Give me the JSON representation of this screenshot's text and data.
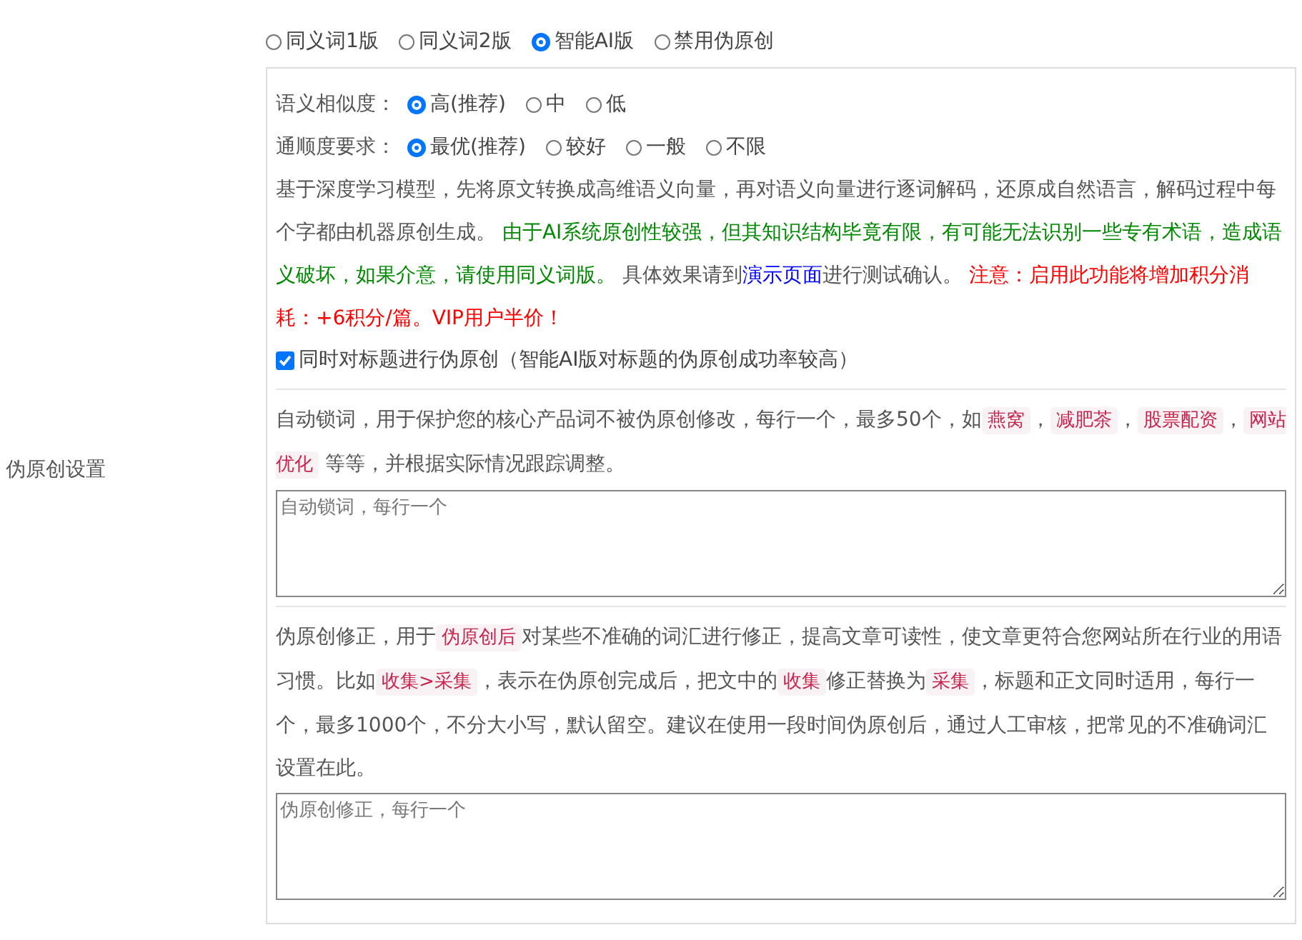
{
  "settings_label": "伪原创设置",
  "versions": [
    {
      "label": "同义词1版",
      "selected": false
    },
    {
      "label": "同义词2版",
      "selected": false
    },
    {
      "label": "智能AI版",
      "selected": true
    },
    {
      "label": "禁用伪原创",
      "selected": false
    }
  ],
  "similarity": {
    "label": "语义相似度：",
    "options": [
      {
        "label": "高(推荐)",
        "selected": true
      },
      {
        "label": "中",
        "selected": false
      },
      {
        "label": "低",
        "selected": false
      }
    ]
  },
  "fluency": {
    "label": "通顺度要求：",
    "options": [
      {
        "label": "最优(推荐)",
        "selected": true
      },
      {
        "label": "较好",
        "selected": false
      },
      {
        "label": "一般",
        "selected": false
      },
      {
        "label": "不限",
        "selected": false
      }
    ]
  },
  "description": [
    {
      "kind": "text",
      "text": "基于深度学习模型，先将原文转换成高维语义向量，再对语义向量进行逐词解码，还原成自然语言，解码过程中每个字都由机器原创生成。 "
    },
    {
      "kind": "green",
      "text": "由于AI系统原创性较强，但其知识结构毕竟有限，有可能无法识别一些专有术语，造成语义破坏，如果介意，请使用同义词版。"
    },
    {
      "kind": "text",
      "text": " 具体效果请到"
    },
    {
      "kind": "link",
      "text": "演示页面"
    },
    {
      "kind": "text",
      "text": "进行测试确认。 "
    },
    {
      "kind": "red",
      "text": "注意：启用此功能将增加积分消耗：+6积分/篇。VIP用户半价！"
    }
  ],
  "title_option": {
    "label": "同时对标题进行伪原创（智能AI版对标题的伪原创成功率较高）",
    "checked": true
  },
  "lock_words": {
    "description": [
      {
        "kind": "text",
        "text": "自动锁词，用于保护您的核心产品词不被伪原创修改，每行一个，最多50个，如"
      },
      {
        "kind": "code",
        "text": "燕窝"
      },
      {
        "kind": "text",
        "text": "，"
      },
      {
        "kind": "code",
        "text": "减肥茶"
      },
      {
        "kind": "text",
        "text": "，"
      },
      {
        "kind": "code",
        "text": "股票配资"
      },
      {
        "kind": "text",
        "text": "，"
      },
      {
        "kind": "code",
        "text": "网站优化"
      },
      {
        "kind": "text",
        "text": " 等等，并根据实际情况跟踪调整。"
      }
    ],
    "placeholder": "自动锁词，每行一个"
  },
  "correction": {
    "description": [
      {
        "kind": "text",
        "text": "伪原创修正，用于"
      },
      {
        "kind": "code",
        "text": "伪原创后"
      },
      {
        "kind": "text",
        "text": "对某些不准确的词汇进行修正，提高文章可读性，使文章更符合您网站所在行业的用语习惯。比如"
      },
      {
        "kind": "code",
        "text": "收集>采集"
      },
      {
        "kind": "text",
        "text": "，表示在伪原创完成后，把文中的"
      },
      {
        "kind": "code",
        "text": "收集"
      },
      {
        "kind": "text",
        "text": "修正替换为"
      },
      {
        "kind": "code",
        "text": "采集"
      },
      {
        "kind": "text",
        "text": "，标题和正文同时适用，每行一个，最多1000个，不分大小写，默认留空。建议在使用一段时间伪原创后，通过人工审核，把常见的不准确词汇设置在此。"
      }
    ],
    "placeholder": "伪原创修正，每行一个"
  }
}
